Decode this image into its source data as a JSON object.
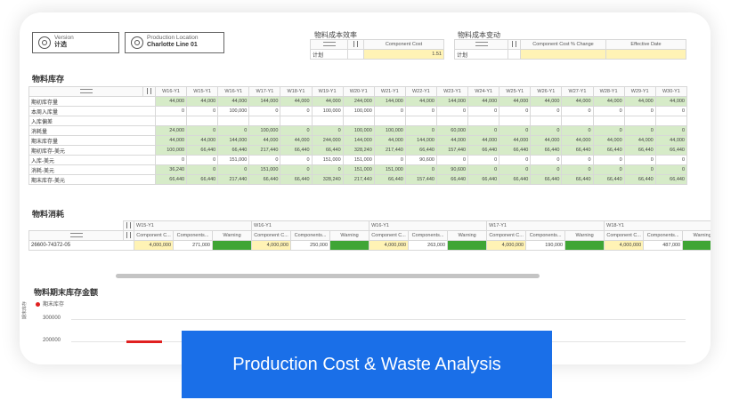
{
  "controls": [
    {
      "line1": "Version",
      "line2": "计选"
    },
    {
      "line1": "Production Location",
      "line2": "Charlotte Line 01"
    }
  ],
  "panel1": {
    "title": "物料成本效率",
    "header": "Component Cost",
    "row_label": "计划",
    "value": "1.51"
  },
  "panel2": {
    "title": "物料成本变动",
    "header_change": "Component Cost % Change",
    "header_date": "Effective Date",
    "row_label": "计划"
  },
  "inventory": {
    "title": "物料库存",
    "weeks": [
      "W16-Y1",
      "W15-Y1",
      "W16-Y1",
      "W17-Y1",
      "W18-Y1",
      "W19-Y1",
      "W20-Y1",
      "W21-Y1",
      "W22-Y1",
      "W23-Y1",
      "W24-Y1",
      "W25-Y1",
      "W26-Y1",
      "W27-Y1",
      "W28-Y1",
      "W29-Y1",
      "W30-Y1"
    ],
    "rows": [
      {
        "label": "期初库存量",
        "values": [
          "44,000",
          "44,000",
          "44,000",
          "144,000",
          "44,000",
          "44,000",
          "244,000",
          "144,000",
          "44,000",
          "144,000",
          "44,000",
          "44,000",
          "44,000",
          "44,000",
          "44,000",
          "44,000",
          "44,000"
        ],
        "green": true
      },
      {
        "label": "本周入库量",
        "values": [
          "0",
          "0",
          "100,000",
          "0",
          "0",
          "100,000",
          "100,000",
          "0",
          "0",
          "0",
          "0",
          "0",
          "0",
          "0",
          "0",
          "0",
          "0"
        ],
        "green": false
      },
      {
        "label": "入库偏差",
        "values": [
          "",
          "",
          "",
          "",
          "",
          "",
          "",
          "",
          "",
          "",
          "",
          "",
          "",
          "",
          "",
          "",
          ""
        ],
        "green": false
      },
      {
        "label": "消耗量",
        "values": [
          "24,000",
          "0",
          "0",
          "100,000",
          "0",
          "0",
          "100,000",
          "100,000",
          "0",
          "60,000",
          "0",
          "0",
          "0",
          "0",
          "0",
          "0",
          "0"
        ],
        "green": true
      },
      {
        "label": "期末库存量",
        "values": [
          "44,000",
          "44,000",
          "144,000",
          "44,000",
          "44,000",
          "244,000",
          "144,000",
          "44,000",
          "144,000",
          "44,000",
          "44,000",
          "44,000",
          "44,000",
          "44,000",
          "44,000",
          "44,000",
          "44,000"
        ],
        "green": true
      },
      {
        "label": "期初库存-美元",
        "values": [
          "100,000",
          "66,440",
          "66,440",
          "217,440",
          "66,440",
          "66,440",
          "328,240",
          "217,440",
          "66,440",
          "157,440",
          "66,440",
          "66,440",
          "66,440",
          "66,440",
          "66,440",
          "66,440",
          "66,440"
        ],
        "green": true
      },
      {
        "label": "入库-美元",
        "values": [
          "0",
          "0",
          "151,000",
          "0",
          "0",
          "151,000",
          "151,000",
          "0",
          "90,600",
          "0",
          "0",
          "0",
          "0",
          "0",
          "0",
          "0",
          "0"
        ],
        "green": false
      },
      {
        "label": "消耗-美元",
        "values": [
          "36,240",
          "0",
          "0",
          "151,000",
          "0",
          "0",
          "151,000",
          "151,000",
          "0",
          "90,600",
          "0",
          "0",
          "0",
          "0",
          "0",
          "0",
          "0"
        ],
        "green": true
      },
      {
        "label": "期末库存-美元",
        "values": [
          "66,440",
          "66,440",
          "217,440",
          "66,440",
          "66,440",
          "328,240",
          "217,440",
          "66,440",
          "157,440",
          "66,440",
          "66,440",
          "66,440",
          "66,440",
          "66,440",
          "66,440",
          "66,440",
          "66,440"
        ],
        "green": true
      }
    ]
  },
  "consumption": {
    "title": "物料消耗",
    "weeks": [
      "W15-Y1",
      "W16-Y1",
      "W16-Y1",
      "W17-Y1",
      "W18-Y1"
    ],
    "subheaders": [
      "Component C...",
      "Components...",
      "Warning"
    ],
    "part": "26600-74372-05",
    "values": [
      [
        "4,000,000",
        "271,000"
      ],
      [
        "4,000,000",
        "250,000"
      ],
      [
        "4,000,000",
        "263,000"
      ],
      [
        "4,000,000",
        "190,000"
      ],
      [
        "4,000,000",
        "487,000"
      ]
    ]
  },
  "chart": {
    "title": "物料期末库存金额",
    "legend": "期末库存",
    "yaxis": "期末库存",
    "ticks": [
      "300000",
      "200000"
    ],
    "line_color": "#e02020"
  },
  "banner": {
    "text": "Production Cost & Waste Analysis"
  }
}
